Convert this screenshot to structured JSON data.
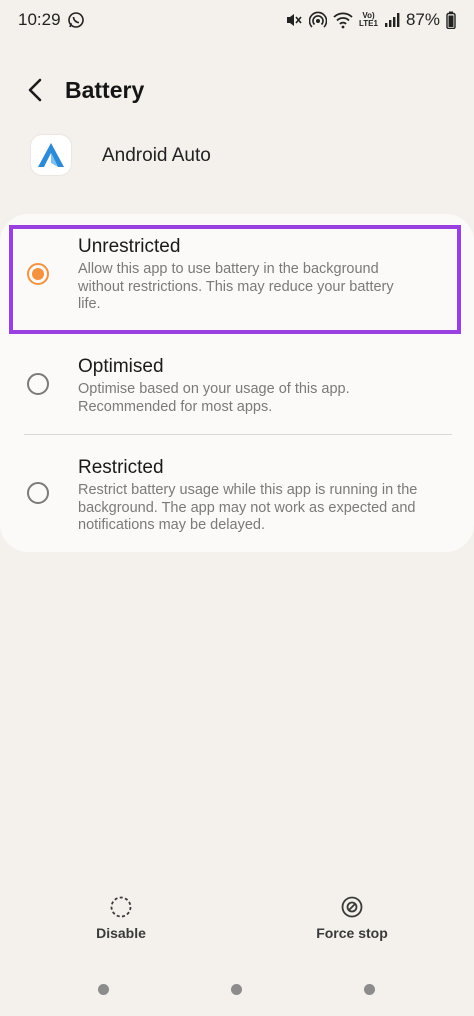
{
  "status_bar": {
    "time": "10:29",
    "battery": "87%",
    "icons": [
      "whatsapp-icon",
      "mute-icon",
      "hotspot-icon",
      "wifi-icon",
      "volte-icon",
      "signal-icon",
      "battery-icon"
    ],
    "volte_label_top": "Vo)",
    "volte_label_bottom": "LTE1"
  },
  "header": {
    "title": "Battery"
  },
  "app": {
    "name": "Android Auto"
  },
  "options": [
    {
      "title": "Unrestricted",
      "description": "Allow this app to use battery in the background without restrictions. This may reduce your battery life.",
      "selected": true
    },
    {
      "title": "Optimised",
      "description": "Optimise based on your usage of this app. Recommended for most apps.",
      "selected": false
    },
    {
      "title": "Restricted",
      "description": "Restrict battery usage while this app is running in the background. The app may not work as expected and notifications may be delayed.",
      "selected": false
    }
  ],
  "bottom_actions": {
    "disable_label": "Disable",
    "force_stop_label": "Force stop"
  },
  "colors": {
    "accent": "#f3923f",
    "highlight": "#9a3fe0",
    "background": "#f4f0ec"
  }
}
